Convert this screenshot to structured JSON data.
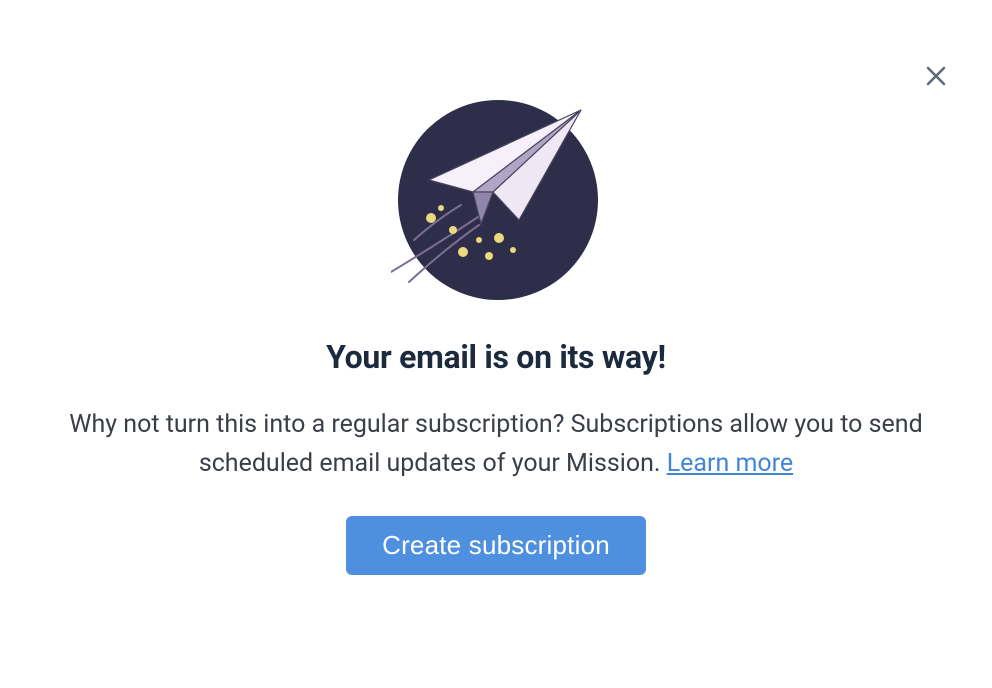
{
  "dialog": {
    "heading": "Your email is on its way!",
    "body_prefix": "Why not turn this into a regular subscription? Subscriptions allow you to send scheduled email updates of your Mission. ",
    "learn_more_label": "Learn more",
    "cta_label": "Create subscription"
  }
}
